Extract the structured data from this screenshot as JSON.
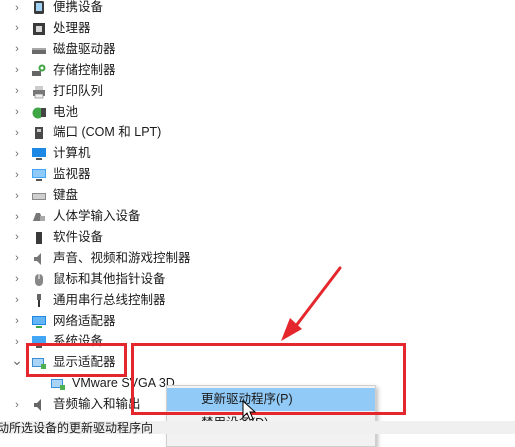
{
  "devices": [
    {
      "label": "便携设备",
      "icon": "portable-device-icon",
      "expanded": false
    },
    {
      "label": "处理器",
      "icon": "processor-icon",
      "expanded": false
    },
    {
      "label": "磁盘驱动器",
      "icon": "disk-drive-icon",
      "expanded": false
    },
    {
      "label": "存储控制器",
      "icon": "storage-controller-icon",
      "expanded": false
    },
    {
      "label": "打印队列",
      "icon": "printer-icon",
      "expanded": false
    },
    {
      "label": "电池",
      "icon": "battery-icon",
      "expanded": false
    },
    {
      "label": "端口 (COM 和 LPT)",
      "icon": "port-icon",
      "expanded": false
    },
    {
      "label": "计算机",
      "icon": "computer-icon",
      "expanded": false
    },
    {
      "label": "监视器",
      "icon": "monitor-icon",
      "expanded": false
    },
    {
      "label": "键盘",
      "icon": "keyboard-icon",
      "expanded": false
    },
    {
      "label": "人体学输入设备",
      "icon": "hid-icon",
      "expanded": false
    },
    {
      "label": "软件设备",
      "icon": "software-device-icon",
      "expanded": false
    },
    {
      "label": "声音、视频和游戏控制器",
      "icon": "speaker-icon",
      "expanded": false
    },
    {
      "label": "鼠标和其他指针设备",
      "icon": "mouse-icon",
      "expanded": false
    },
    {
      "label": "通用串行总线控制器",
      "icon": "usb-icon",
      "expanded": false
    },
    {
      "label": "网络适配器",
      "icon": "network-adapter-icon",
      "expanded": false
    },
    {
      "label": "系统设备",
      "icon": "system-device-icon",
      "expanded": false
    },
    {
      "label": "显示适配器",
      "icon": "display-adapter-icon",
      "expanded": true
    },
    {
      "label": "VMware SVGA 3D",
      "icon": "display-adapter-icon",
      "child": true
    },
    {
      "label": "音频输入和输出",
      "icon": "audio-io-icon",
      "expanded": false
    }
  ],
  "context_menu": {
    "update_driver": "更新驱动程序(P)",
    "disable_device": "禁用设备(D)"
  },
  "status_bar": "动所选设备的更新驱动程序向",
  "colors": {
    "highlight_box": "#e4272d",
    "menu_hover": "#91c9f7"
  }
}
